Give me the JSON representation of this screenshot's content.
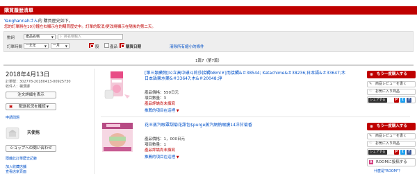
{
  "page": {
    "title": "購買履歴清單"
  },
  "greeting": {
    "user": "Yanghannahさん",
    "text": "的 購買歷史如下。"
  },
  "notice": "您的訂單將在10分鐘左右顯示在的購買歷史中。訂單的取消/更改將顯示在隨後的第二天。",
  "search": {
    "keyword_label": "數詞",
    "field_select": "產品名稱",
    "keyword_placeholder": "將名稱輸入",
    "period_label": "訂單時間",
    "year_select": "一年年",
    "month_select": "一月",
    "options": [
      "股",
      "產品",
      "購買日期"
    ],
    "clear_label": "清除所有縮小的條件"
  },
  "pagination": {
    "text": "1篇7（第7篇）"
  },
  "order": {
    "date": "2018年4月13日",
    "order_no": "訂單號：302778-20180413-00925730",
    "seller": "收件人：楊漢娜",
    "detail_button": "注文詳細を表示",
    "delivery_button": "配送状況を確認",
    "link_inquiry": "申請問題",
    "shop_name": "天使拖",
    "contact_button": "ショップへの問い合わせ",
    "link_history": "隱藏此訂單歷史記錄",
    "link_add": "加入收藏店舖",
    "link_view": "查看店家頁面"
  },
  "items": [
    {
      "title": "[第三類藥物]公立高中碘斗莉莎接觸b8ml￥|而接觸&＃38544; Katachime&＃38236;日本語&＃33647;木日本語樂水藥&＃33647;木&＃20048;淳",
      "price": "產品價格：550日元",
      "qty": "項目數量：3",
      "status": "產品評論尚未撰寫",
      "rec": "推薦的項目在這裡"
    },
    {
      "title": "花王蒸汽眼罩甜菊花甜包$purge蒸汽網熱眼膜14洋甘菊香",
      "price": "產品價格：1，000日元",
      "qty": "項目數量：1",
      "status": "產品評論尚未撰寫",
      "rec": "推薦的項目在這裡"
    }
  ],
  "actions": {
    "rebuy": "もう一度購入する",
    "review": "商品レビューを書く",
    "favorite": "お気に入り商品",
    "share": "シェアする",
    "room": "ROOMに投稿する",
    "room_link": "什麼是\"ROOM\"？"
  },
  "colors": {
    "accent": "#bf0000",
    "link": "#0050c8"
  }
}
